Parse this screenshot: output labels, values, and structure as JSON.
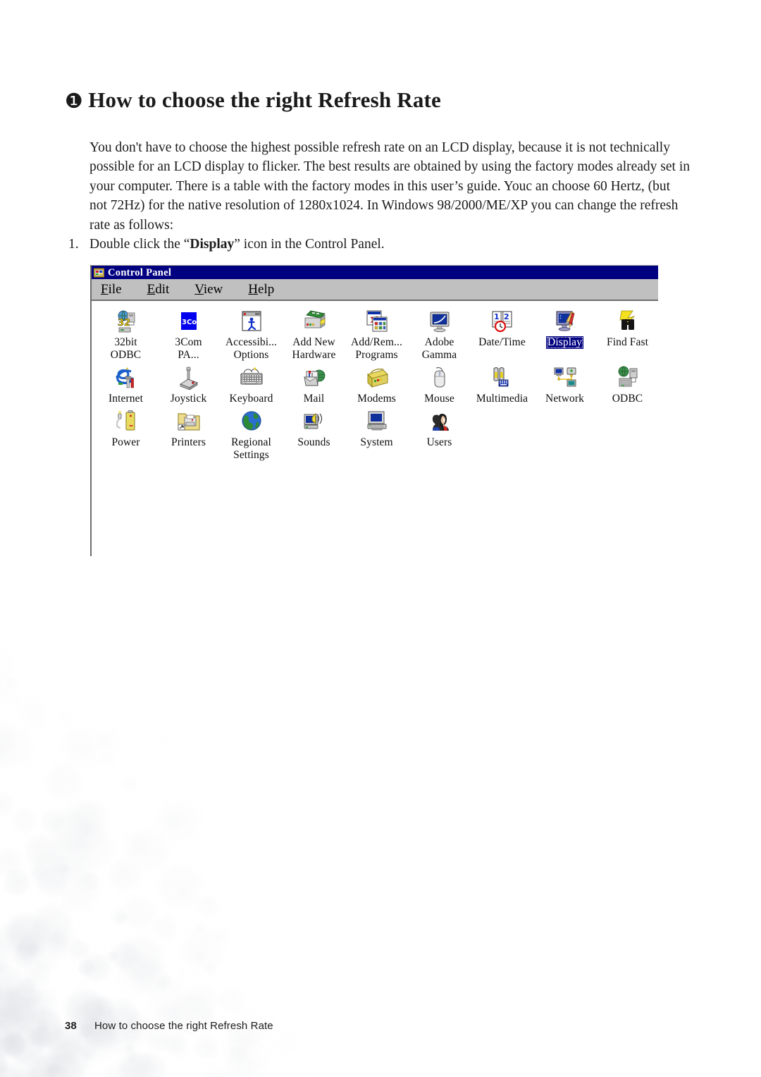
{
  "document": {
    "page_number": "38",
    "footer_title": "How to choose the right Refresh Rate"
  },
  "heading": {
    "bullet": "❶",
    "text": "How to choose the right Refresh Rate"
  },
  "intro": {
    "paragraph": "You don't have to choose the highest possible refresh rate on an LCD display, because it is not technically possible for an LCD display to flicker. The best results are obtained by using the factory modes already set in your computer. There is a table with the factory modes in this user’s guide. Youc an choose 60 Hertz, (but not 72Hz) for the native resolution of 1280x1024. In Windows 98/2000/ME/XP you can change the refresh rate as follows:"
  },
  "steps": [
    {
      "number": "1.",
      "prefix": "Double click the “",
      "emphasis": "Display",
      "suffix": "” icon in the Control Panel."
    }
  ],
  "control_panel_window": {
    "title": "Control Panel",
    "title_icon": "control-panel-folder-icon",
    "titlebar_color": "#000080",
    "chrome_color": "#c0c0c0",
    "selection_color": "#000080",
    "menu": [
      {
        "label": "File",
        "mnemonic": "F"
      },
      {
        "label": "Edit",
        "mnemonic": "E"
      },
      {
        "label": "View",
        "mnemonic": "V"
      },
      {
        "label": "Help",
        "mnemonic": "H"
      }
    ],
    "icon_rows": [
      [
        {
          "label": "32bit\nODBC",
          "icon": "odbc-32bit-icon",
          "selected": false
        },
        {
          "label": "3Com\nPA...",
          "icon": "3com-pa-icon",
          "selected": false
        },
        {
          "label": "Accessibi...\nOptions",
          "icon": "accessibility-options-icon",
          "selected": false
        },
        {
          "label": "Add New\nHardware",
          "icon": "add-new-hardware-icon",
          "selected": false
        },
        {
          "label": "Add/Rem...\nPrograms",
          "icon": "add-remove-programs-icon",
          "selected": false
        },
        {
          "label": "Adobe\nGamma",
          "icon": "adobe-gamma-icon",
          "selected": false
        },
        {
          "label": "Date/Time",
          "icon": "date-time-icon",
          "selected": false
        },
        {
          "label": "Display",
          "icon": "display-icon",
          "selected": true
        },
        {
          "label": "Find Fast",
          "icon": "find-fast-icon",
          "selected": false
        }
      ],
      [
        {
          "label": "Internet",
          "icon": "internet-options-icon",
          "selected": false
        },
        {
          "label": "Joystick",
          "icon": "joystick-icon",
          "selected": false
        },
        {
          "label": "Keyboard",
          "icon": "keyboard-icon",
          "selected": false
        },
        {
          "label": "Mail",
          "icon": "mail-icon",
          "selected": false
        },
        {
          "label": "Modems",
          "icon": "modems-icon",
          "selected": false
        },
        {
          "label": "Mouse",
          "icon": "mouse-icon",
          "selected": false
        },
        {
          "label": "Multimedia",
          "icon": "multimedia-icon",
          "selected": false
        },
        {
          "label": "Network",
          "icon": "network-icon",
          "selected": false
        },
        {
          "label": "ODBC",
          "icon": "odbc-icon",
          "selected": false
        }
      ],
      [
        {
          "label": "Power",
          "icon": "power-management-icon",
          "selected": false
        },
        {
          "label": "Printers",
          "icon": "printers-icon",
          "selected": false
        },
        {
          "label": "Regional\nSettings",
          "icon": "regional-settings-icon",
          "selected": false
        },
        {
          "label": "Sounds",
          "icon": "sounds-icon",
          "selected": false
        },
        {
          "label": "System",
          "icon": "system-icon",
          "selected": false
        },
        {
          "label": "Users",
          "icon": "users-icon",
          "selected": false
        }
      ]
    ]
  }
}
